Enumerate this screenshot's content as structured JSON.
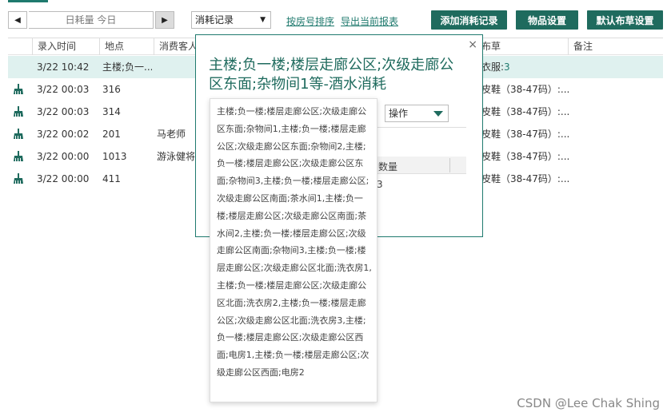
{
  "toolbar": {
    "prev_icon": "◀",
    "next_icon": "▶",
    "date_label": "日耗量 今日",
    "record_select": "消耗记录",
    "select_caret": "▼",
    "sort_link": "按房号排序",
    "export_link": "导出当前报表",
    "add_button": "添加消耗记录",
    "items_button": "物品设置",
    "cloth_button": "默认布草设置"
  },
  "table": {
    "headers": {
      "time": "录入时间",
      "place": "地点",
      "customer": "消费客人",
      "cloth": "布草",
      "note": "备注"
    },
    "rows": [
      {
        "time": "3/22 10:42",
        "place": "主楼;负一...",
        "customer": "",
        "cloth": "衣服:",
        "cloth_num": "3",
        "icon": false,
        "selected": true
      },
      {
        "time": "3/22 00:03",
        "place": "316",
        "customer": "",
        "cloth": "皮鞋（38-47码）:...",
        "cloth_num": "",
        "icon": true,
        "selected": false
      },
      {
        "time": "3/22 00:03",
        "place": "314",
        "customer": "",
        "cloth": "皮鞋（38-47码）:...",
        "cloth_num": "",
        "icon": true,
        "selected": false
      },
      {
        "time": "3/22 00:02",
        "place": "201",
        "customer": "马老师",
        "cloth": "皮鞋（38-47码）:...",
        "cloth_num": "",
        "icon": true,
        "selected": false
      },
      {
        "time": "3/22 00:00",
        "place": "1013",
        "customer": "游泳健将",
        "cloth": "皮鞋（38-47码）:...",
        "cloth_num": "",
        "icon": true,
        "selected": false
      },
      {
        "time": "3/22 00:00",
        "place": "411",
        "customer": "",
        "cloth": "皮鞋（38-47码）:...",
        "cloth_num": "",
        "icon": true,
        "selected": false
      }
    ]
  },
  "modal": {
    "close": "×",
    "title": "主楼;负一楼;楼层走廊公区;次级走廊公区东面;杂物间1等-酒水消耗",
    "operation_select": "操作",
    "qty_header": "数量",
    "qty_value": "3"
  },
  "tooltip": {
    "text": "主楼;负一楼;楼层走廊公区;次级走廊公区东面;杂物间1,主楼;负一楼;楼层走廊公区;次级走廊公区东面;杂物间2,主楼;负一楼;楼层走廊公区;次级走廊公区东面;杂物间3,主楼;负一楼;楼层走廊公区;次级走廊公区南面;茶水间1,主楼;负一楼;楼层走廊公区;次级走廊公区南面;茶水间2,主楼;负一楼;楼层走廊公区;次级走廊公区南面;杂物间3,主楼;负一楼;楼层走廊公区;次级走廊公区北面;洗衣房1,主楼;负一楼;楼层走廊公区;次级走廊公区北面;洗衣房2,主楼;负一楼;楼层走廊公区;次级走廊公区北面;洗衣房3,主楼;负一楼;楼层走廊公区;次级走廊公区西面;电房1,主楼;负一楼;楼层走廊公区;次级走廊公区西面;电房2"
  },
  "watermark": "CSDN @Lee Chak Shing",
  "colors": {
    "accent": "#1f6b5e",
    "selected_row": "#dff1ef"
  }
}
